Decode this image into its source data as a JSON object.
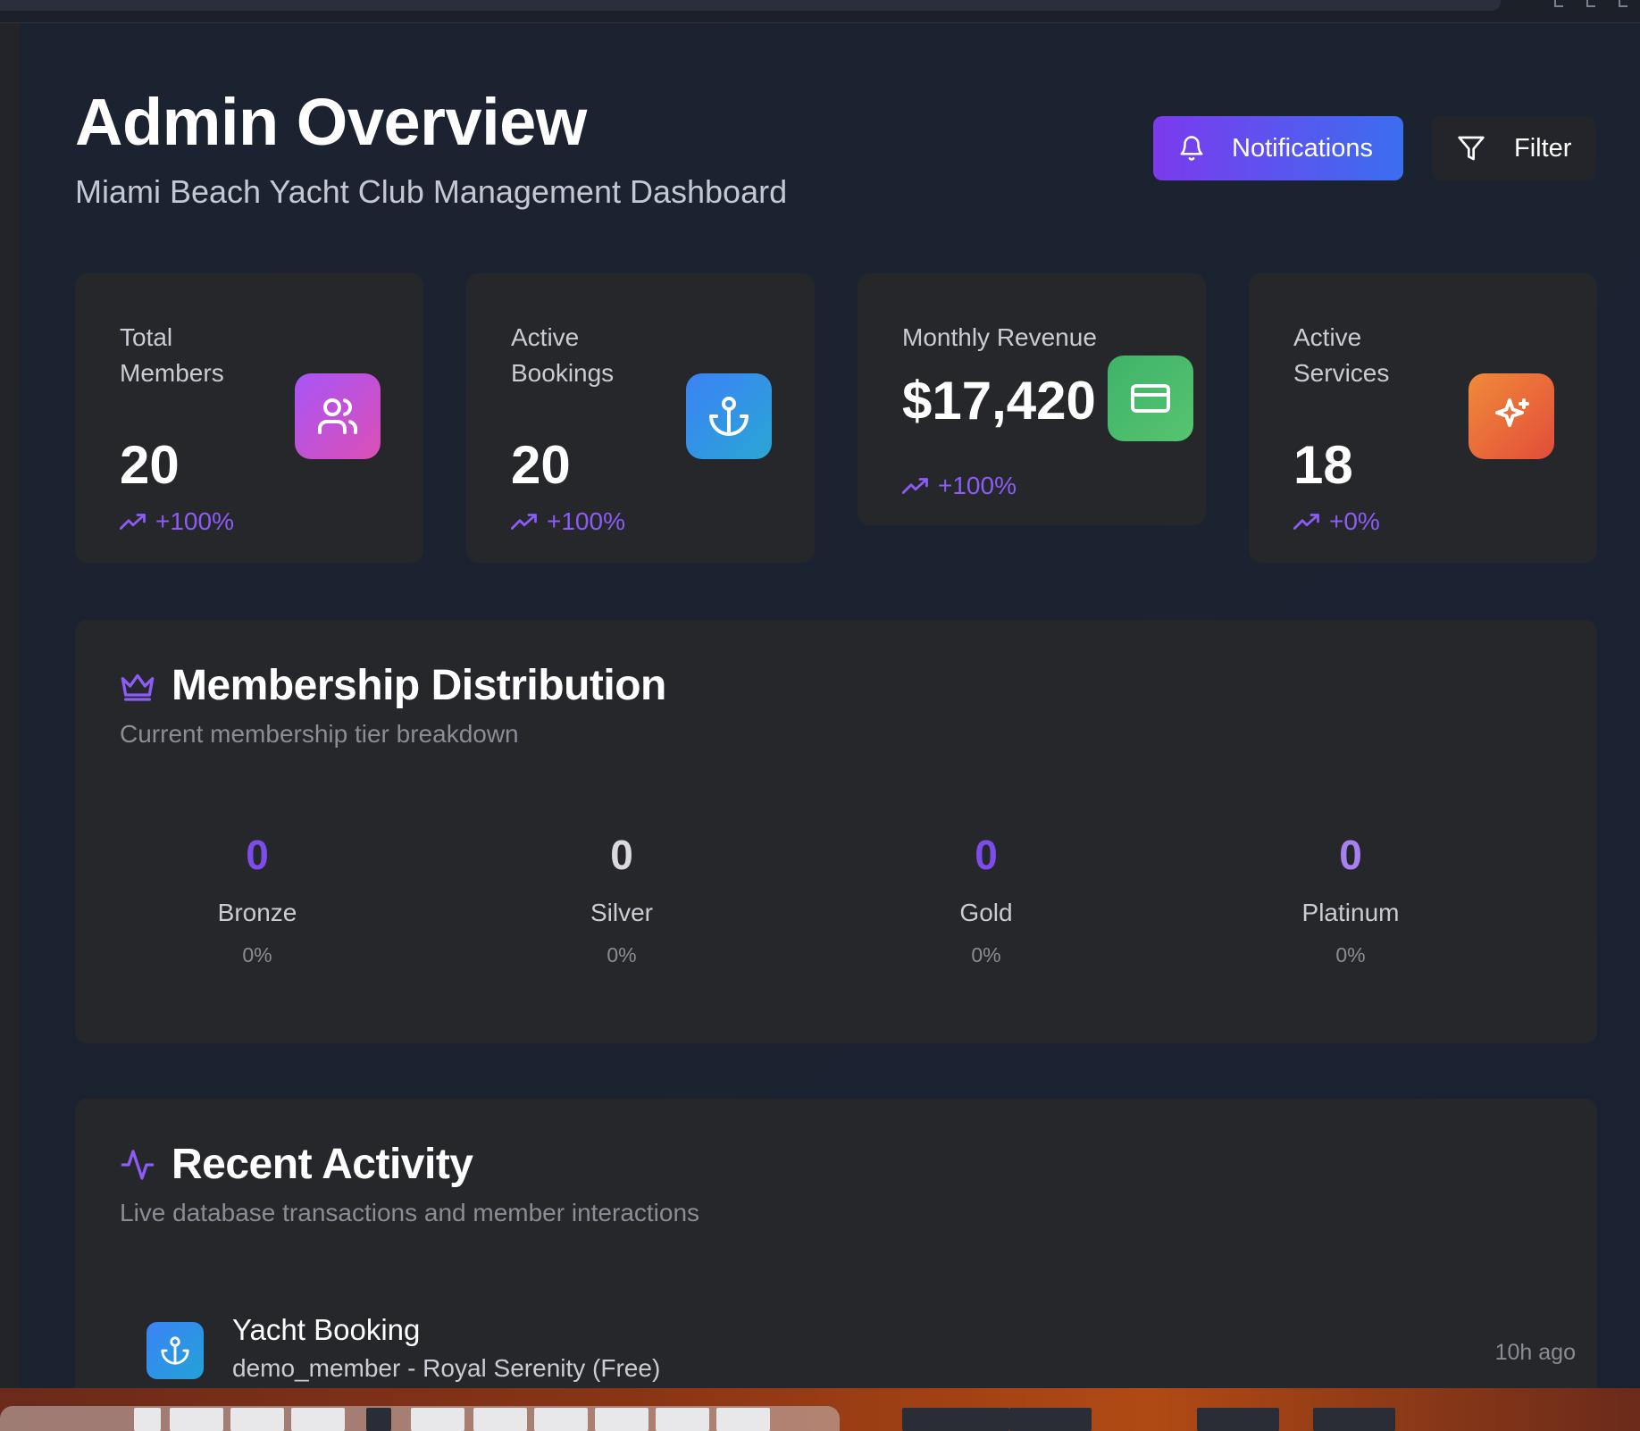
{
  "header": {
    "title": "Admin Overview",
    "subtitle": "Miami Beach Yacht Club Management Dashboard",
    "notifications_label": "Notifications",
    "filter_label": "Filter"
  },
  "stats": [
    {
      "label_line1": "Total",
      "label_line2": "Members",
      "value": "20",
      "trend": "+100%",
      "icon": "users-icon",
      "color": "#b44fd6"
    },
    {
      "label_line1": "Active",
      "label_line2": "Bookings",
      "value": "20",
      "trend": "+100%",
      "icon": "anchor-icon",
      "color": "#3a8fe6"
    },
    {
      "label_line1": "Monthly Revenue",
      "label_line2": "",
      "value": "$17,420",
      "trend": "+100%",
      "icon": "credit-card-icon",
      "color": "#4cc06a"
    },
    {
      "label_line1": "Active",
      "label_line2": "Services",
      "value": "18",
      "trend": "+0%",
      "icon": "sparkles-icon",
      "color": "#ea6b3a"
    }
  ],
  "membership": {
    "title": "Membership Distribution",
    "subtitle": "Current membership tier breakdown",
    "tiers": [
      {
        "count": "0",
        "name": "Bronze",
        "pct": "0%",
        "color": "#7c4dea"
      },
      {
        "count": "0",
        "name": "Silver",
        "pct": "0%",
        "color": "#d9d9de"
      },
      {
        "count": "0",
        "name": "Gold",
        "pct": "0%",
        "color": "#7c4dea"
      },
      {
        "count": "0",
        "name": "Platinum",
        "pct": "0%",
        "color": "#a682f0"
      }
    ]
  },
  "activity": {
    "title": "Recent Activity",
    "subtitle": "Live database transactions and member interactions",
    "items": [
      {
        "title": "Yacht Booking",
        "desc": "demo_member - Royal Serenity (Free)",
        "time": "10h ago",
        "icon": "anchor-icon"
      }
    ]
  },
  "colors": {
    "accent": "#8b5cf6",
    "card_bg": "#26272b",
    "page_bg": "#1b2230"
  }
}
